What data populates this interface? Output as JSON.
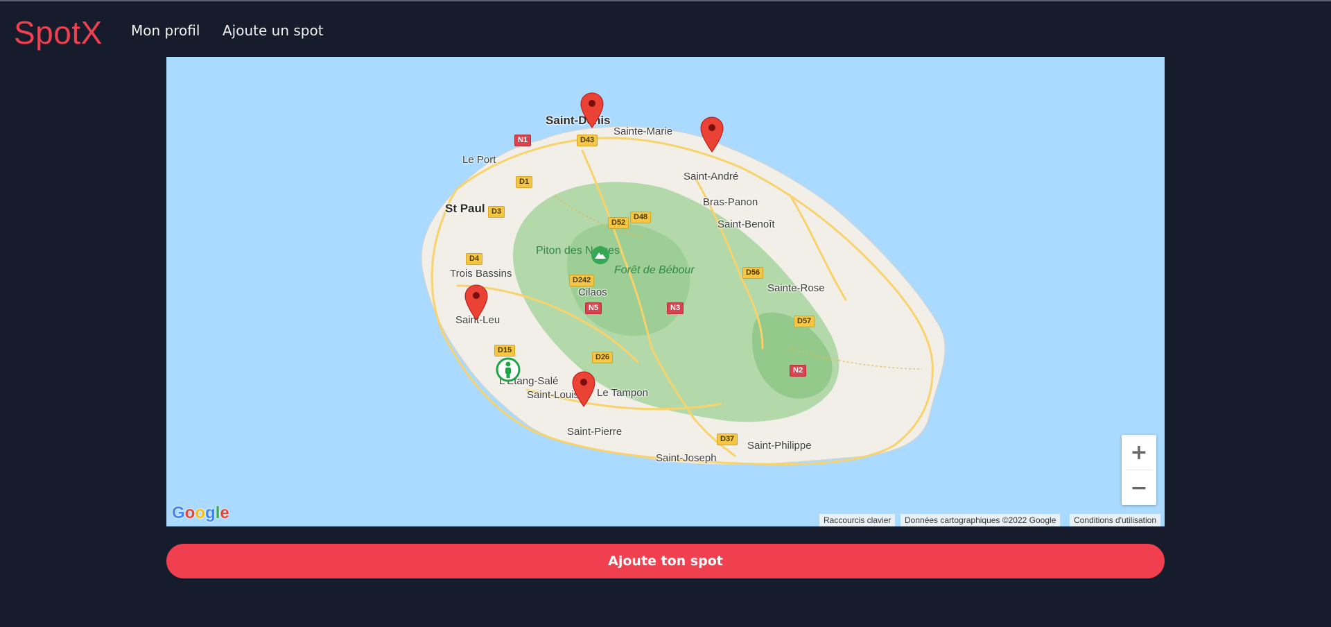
{
  "brand": {
    "name": "SpotX",
    "color": "#f0404f"
  },
  "nav": {
    "items": [
      {
        "label": "Mon profil"
      },
      {
        "label": "Ajoute un spot"
      }
    ]
  },
  "map": {
    "places": {
      "saint_denis": "Saint-Denis",
      "sainte_marie": "Sainte-Marie",
      "le_port": "Le Port",
      "saint_andre": "Saint-André",
      "st_paul": "St Paul",
      "bras_panon": "Bras-Panon",
      "saint_benoit": "Saint-Benoît",
      "piton_des_neiges": "Piton des Neiges",
      "foret_de_bebour": "Forêt de Bébour",
      "trois_bassins": "Trois Bassins",
      "sainte_rose": "Sainte-Rose",
      "cilaos": "Cilaos",
      "saint_leu": "Saint-Leu",
      "etang_sale": "L'Étang-Salé",
      "saint_louis": "Saint-Louis",
      "le_tampon": "Le Tampon",
      "saint_pierre": "Saint-Pierre",
      "saint_philippe": "Saint-Philippe",
      "saint_joseph": "Saint-Joseph"
    },
    "roads": {
      "n1": "N1",
      "d43": "D43",
      "d1": "D1",
      "d3": "D3",
      "d52": "D52",
      "d48": "D48",
      "d4": "D4",
      "d56": "D56",
      "d242": "D242",
      "n5": "N5",
      "n3": "N3",
      "d57": "D57",
      "d15": "D15",
      "d26": "D26",
      "n2": "N2",
      "d37": "D37"
    },
    "zoom_in_label": "+",
    "zoom_out_label": "−",
    "google_logo": "Google",
    "attribution": {
      "shortcuts": "Raccourcis clavier",
      "data": "Données cartographiques ©2022 Google",
      "terms": "Conditions d'utilisation"
    },
    "colors": {
      "water": "#aadaff",
      "land": "#f2efe9",
      "forest": "#a8d5a0",
      "marker": "#ea4335"
    }
  },
  "cta": {
    "label": "Ajoute ton spot",
    "color": "#f0404f"
  }
}
